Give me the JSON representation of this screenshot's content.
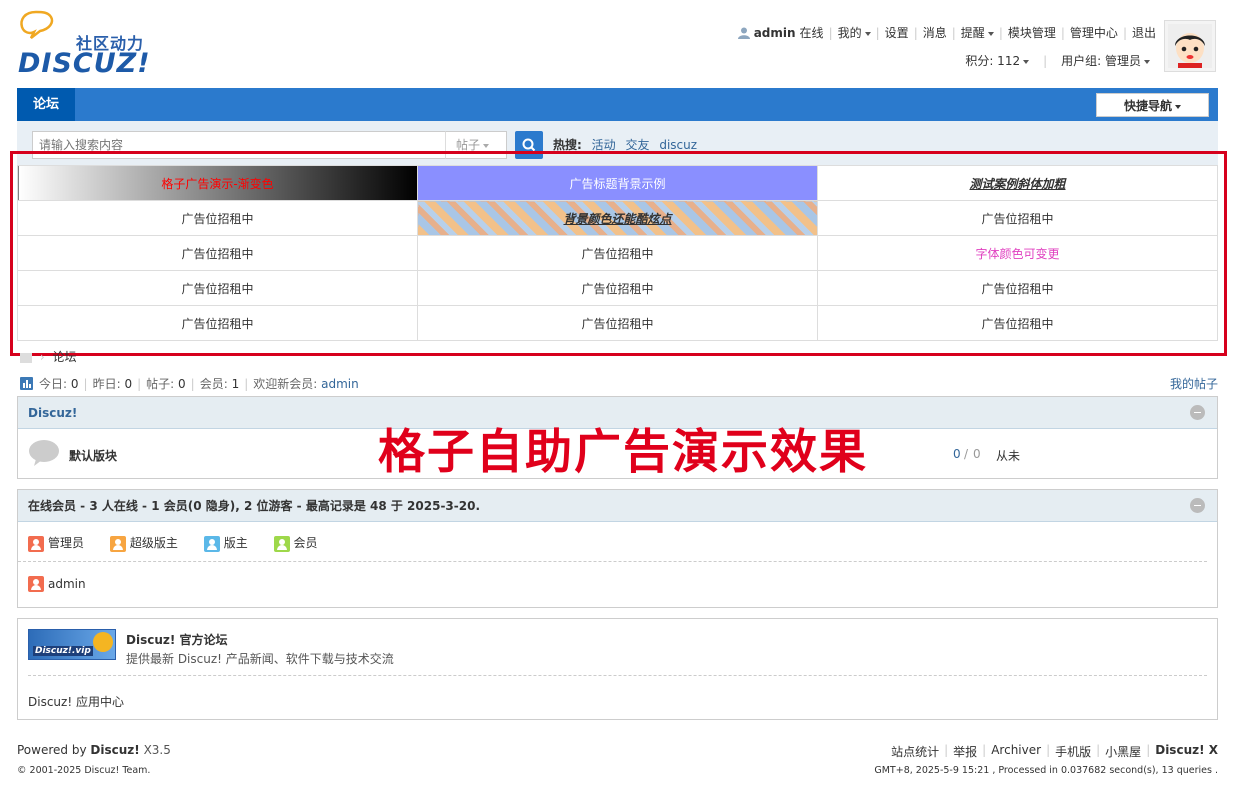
{
  "logo": {
    "tagline": "社区动力",
    "brand": "DISCUZ!"
  },
  "userbar": {
    "username": "admin",
    "status": "在线",
    "items": [
      "我的",
      "设置",
      "消息",
      "提醒",
      "模块管理",
      "管理中心",
      "退出"
    ],
    "points_label": "积分: 112",
    "usergroup_label": "用户组: 管理员"
  },
  "nav": {
    "forum": "论坛",
    "quicknav": "快捷导航"
  },
  "search": {
    "placeholder": "请输入搜索内容",
    "type": "帖子",
    "hot_label": "热搜:",
    "hot_keywords": [
      "活动",
      "交友",
      "discuz"
    ]
  },
  "adgrid": {
    "rows": [
      [
        "格子广告演示-渐变色",
        "广告标题背景示例",
        "测试案例斜体加粗"
      ],
      [
        "广告位招租中",
        "背景颜色还能酷炫点",
        "广告位招租中"
      ],
      [
        "广告位招租中",
        "广告位招租中",
        "字体颜色可变更"
      ],
      [
        "广告位招租中",
        "广告位招租中",
        "广告位招租中"
      ],
      [
        "广告位招租中",
        "广告位招租中",
        "广告位招租中"
      ]
    ],
    "colors": {
      "red_text": "#ff0000",
      "blue_bg": "#8a8fff",
      "pink_text": "#e040c0"
    }
  },
  "overlay": {
    "title": "格子自助广告演示效果"
  },
  "breadcrumb": {
    "forum": "论坛"
  },
  "stats": {
    "today_label": "今日:",
    "today": "0",
    "yesterday_label": "昨日:",
    "yesterday": "0",
    "posts_label": "帖子:",
    "posts": "0",
    "members_label": "会员:",
    "members": "1",
    "welcome_label": "欢迎新会员:",
    "newest": "admin",
    "my_posts": "我的帖子"
  },
  "category": {
    "title": "Discuz!",
    "forum_name": "默认版块",
    "threads": "0",
    "slash": "/",
    "replies": "0",
    "last_post": "从未"
  },
  "online": {
    "title": "在线会员 - 3 人在线 - 1 会员(0 隐身), 2 位游客 - 最高记录是 48 于 2025-3-20.",
    "legend": [
      {
        "label": "管理员",
        "color": "#f26c4f"
      },
      {
        "label": "超级版主",
        "color": "#f7a541"
      },
      {
        "label": "版主",
        "color": "#5bb8e8"
      },
      {
        "label": "会员",
        "color": "#9ed84a"
      }
    ],
    "users": [
      "admin"
    ]
  },
  "links": {
    "logo_text": "Discuz!.vip",
    "name": "Discuz! 官方论坛",
    "desc": "提供最新 Discuz! 产品新闻、软件下载与技术交流",
    "extra": "Discuz! 应用中心"
  },
  "footer": {
    "powered_prefix": "Powered by",
    "powered_brand": "Discuz!",
    "version": "X3.5",
    "copyright_prefix": "© 2001-2025",
    "copyright_brand": "Discuz!",
    "copyright_suffix": "Team.",
    "links": [
      "站点统计",
      "举报",
      "Archiver",
      "手机版",
      "小黑屋"
    ],
    "brand": "Discuz! X",
    "info": "GMT+8, 2025-5-9 15:21 , Processed in 0.037682 second(s), 13 queries ."
  }
}
